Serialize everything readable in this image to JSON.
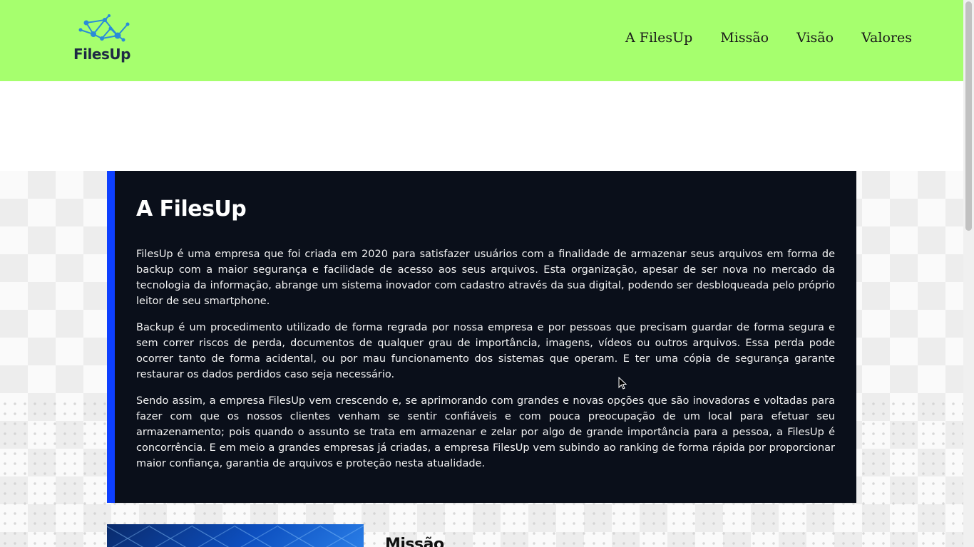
{
  "header": {
    "logo_text": "FilesUp",
    "nav": [
      "A FilesUp",
      "Missão",
      "Visão",
      "Valores"
    ]
  },
  "about": {
    "title": "A FilesUp",
    "paragraphs": [
      "FilesUp é uma empresa que foi criada em 2020 para satisfazer usuários com a finalidade de armazenar seus arquivos em forma de backup com a maior segurança e facilidade de acesso aos seus arquivos. Esta organização, apesar de ser nova no mercado da tecnologia da informação, abrange um sistema inovador com cadastro através da sua digital, podendo ser desbloqueada pelo próprio leitor de seu smartphone.",
      "Backup é um procedimento utilizado de forma regrada por nossa empresa e por pessoas que precisam guardar de forma segura e sem correr riscos de perda, documentos de qualquer grau de importância, imagens, vídeos ou outros arquivos. Essa perda pode ocorrer tanto de forma acidental, ou por mau funcionamento dos sistemas que operam. E ter uma cópia de segurança garante restaurar os dados perdidos caso seja necessário.",
      "Sendo assim, a empresa FilesUp vem crescendo e, se aprimorando com grandes e novas opções que são inovadoras e voltadas para fazer com que os nossos clientes venham se sentir confiáveis e com pouca preocupação de um local para efetuar seu armazenamento; pois quando o assunto se trata em armazenar e zelar por algo de grande importância para a pessoa, a FilesUp é concorrência. E em meio a grandes empresas já criadas, a empresa FilesUp vem subindo ao ranking de forma rápida por proporcionar maior confiança, garantia de arquivos e proteção nesta atualidade."
    ]
  },
  "missao": {
    "title": "Missão"
  },
  "colors": {
    "header_bg": "#a6ff6e",
    "card_bg": "#0a0f1a",
    "accent": "#0d3fff"
  },
  "icons": [
    "network-logo-icon",
    "mouse-cursor-icon"
  ]
}
